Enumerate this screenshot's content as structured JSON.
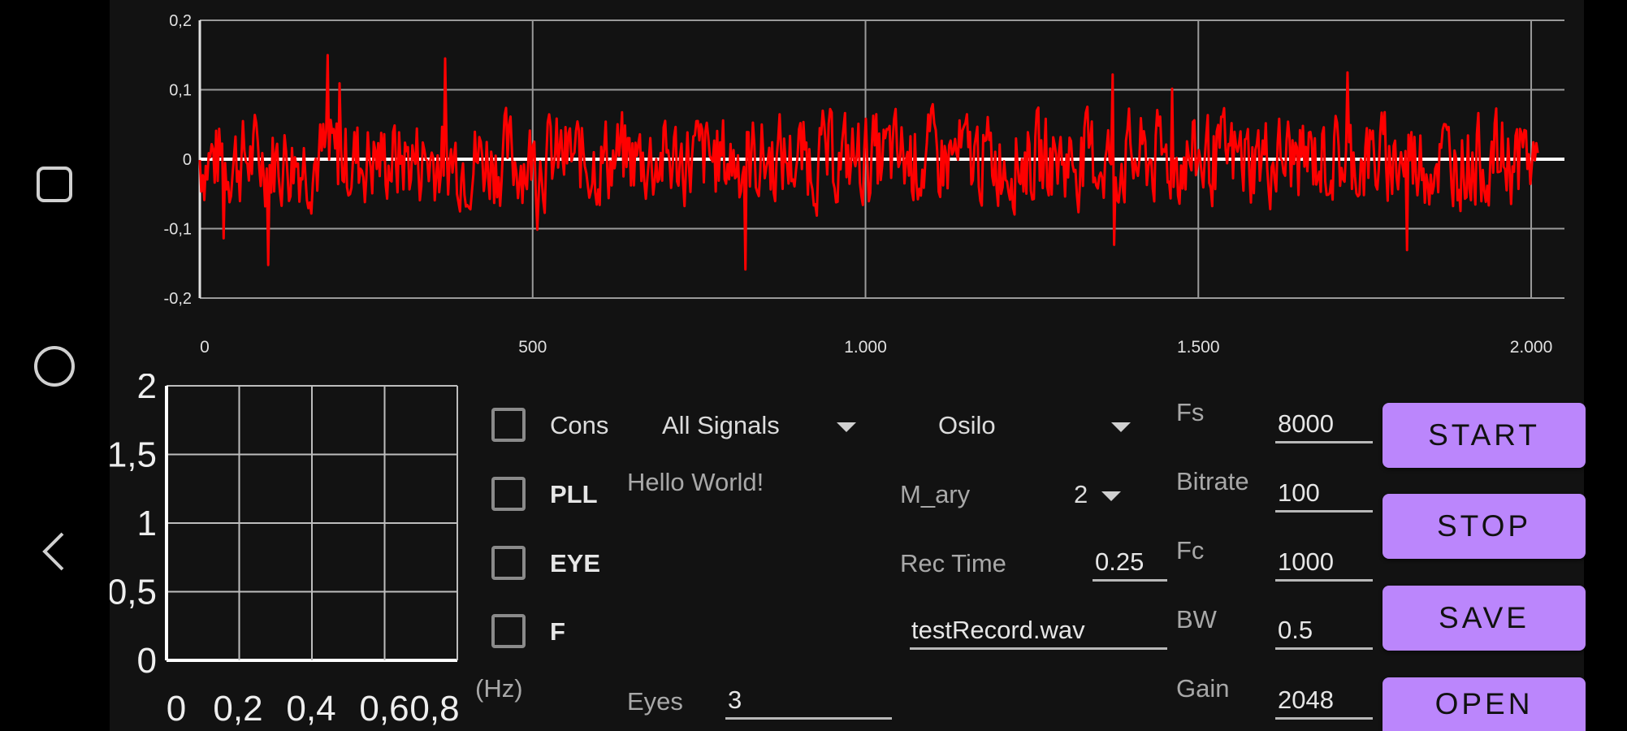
{
  "osc_chart": {
    "type": "line",
    "y_ticks": [
      "0,2",
      "0,1",
      "0",
      "-0,1",
      "-0,2"
    ],
    "y_tick_values": [
      0.2,
      0.1,
      0,
      -0.1,
      -0.2
    ],
    "x_ticks": [
      "0",
      "500",
      "1.000",
      "1.500",
      "2.000"
    ],
    "x_tick_values": [
      0,
      500,
      1000,
      1500,
      2000
    ],
    "xlim": [
      0,
      2050
    ],
    "ylim": [
      -0.2,
      0.2
    ],
    "grid": true,
    "series_color": "#ff0000",
    "baseline_color": "#ffffff"
  },
  "small_chart": {
    "y_ticks": [
      "2",
      "1,5",
      "1",
      "0,5",
      "0"
    ],
    "x_ticks": [
      "0",
      "0,2",
      "0,4",
      "0,6",
      "0,8"
    ]
  },
  "hz_label": "(Hz)",
  "checkboxes": {
    "cons": "Cons",
    "pll": "PLL",
    "eye": "EYE",
    "f": "F"
  },
  "dropdowns": {
    "signals": "All Signals",
    "mode": "Osilo",
    "m_ary_value": "2"
  },
  "labels": {
    "hello": "Hello World!",
    "m_ary": "M_ary",
    "rec_time": "Rec Time",
    "eyes": "Eyes",
    "fs": "Fs",
    "bitrate": "Bitrate",
    "fc": "Fc",
    "bw": "BW",
    "gain": "Gain"
  },
  "inputs": {
    "rec_time": "0.25",
    "file_name": "testRecord.wav",
    "eyes": "3",
    "fs": "8000",
    "bitrate": "100",
    "fc": "1000",
    "bw": "0.5",
    "gain": "2048"
  },
  "buttons": {
    "start": "START",
    "stop": "STOP",
    "save": "SAVE",
    "open": "OPEN"
  },
  "colors": {
    "accent": "#bb86fc",
    "signal": "#ff0000"
  },
  "icons": {
    "recents": "square-icon",
    "home": "circle-icon",
    "back": "chevron-left-icon"
  }
}
